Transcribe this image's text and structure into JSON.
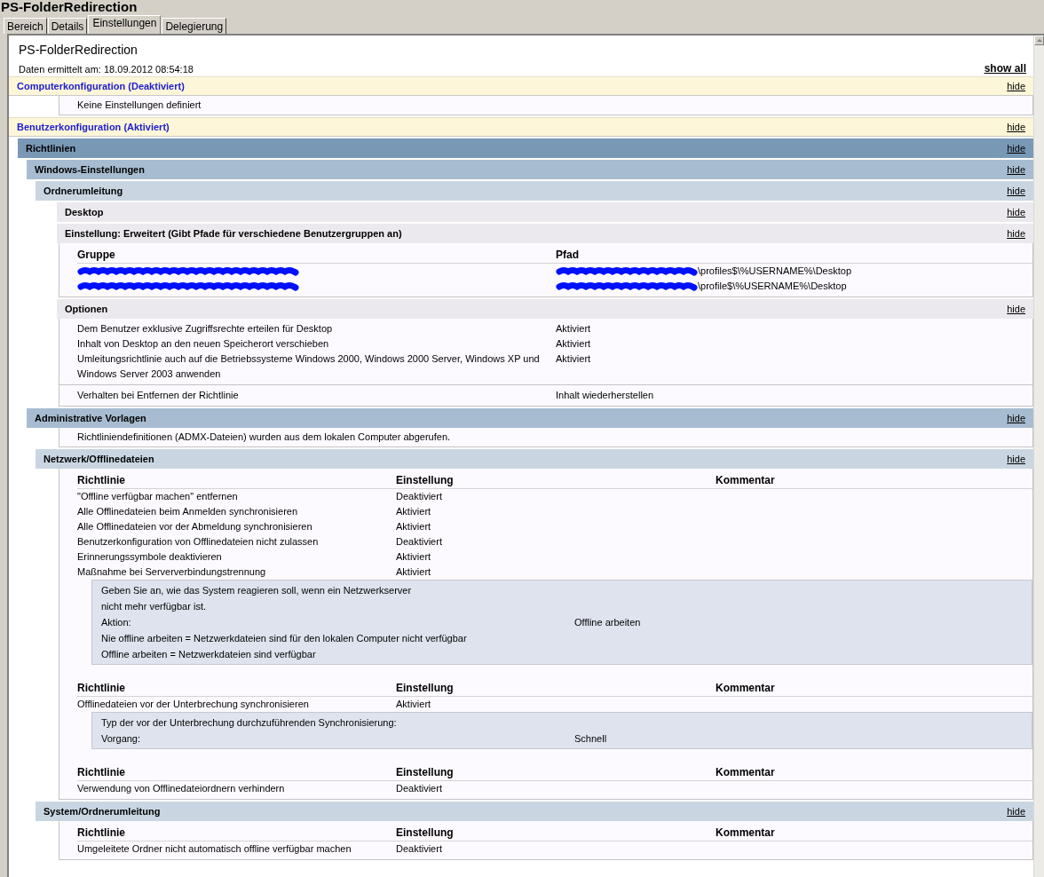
{
  "window": {
    "title": "PS-FolderRedirection"
  },
  "tabs": [
    {
      "label": "Bereich",
      "selected": false
    },
    {
      "label": "Details",
      "selected": false
    },
    {
      "label": "Einstellungen",
      "selected": true
    },
    {
      "label": "Delegierung",
      "selected": false
    }
  ],
  "report": {
    "title": "PS-FolderRedirection",
    "date": "Daten ermittelt am: 18.09.2012 08:54:18",
    "show_all": "show all",
    "sections": [
      {
        "kind": "config",
        "title": "Computerkonfiguration (Deaktiviert)",
        "hide": "hide",
        "blocks": [
          {
            "kind": "note",
            "text": "Keine Einstellungen definiert"
          }
        ]
      },
      {
        "kind": "config",
        "title": "Benutzerkonfiguration (Aktiviert)",
        "hide": "hide",
        "children": [
          {
            "kind": "group",
            "title": "Richtlinien",
            "hide": "hide",
            "children": [
              {
                "kind": "group",
                "title": "Windows-Einstellungen",
                "hide": "hide",
                "children": [
                  {
                    "kind": "group",
                    "title": "Ordnerumleitung",
                    "hide": "hide",
                    "children": [
                      {
                        "kind": "group",
                        "title": "Desktop",
                        "hide": "hide"
                      },
                      {
                        "kind": "group",
                        "title": "Einstellung: Erweitert (Gibt Pfade für verschiedene Benutzergruppen an)",
                        "hide": "hide",
                        "blocks": [
                          {
                            "kind": "table",
                            "columns": [
                              "Gruppe",
                              "Pfad"
                            ],
                            "rows": [
                              {
                                "cells": [
                                  {
                                    "redacted": true
                                  },
                                  {
                                    "redacted": true,
                                    "text": "\\profiles$\\%USERNAME%\\Desktop"
                                  }
                                ]
                              },
                              {
                                "cells": [
                                  {
                                    "redacted": true
                                  },
                                  {
                                    "redacted": true,
                                    "text": "\\profile$\\%USERNAME%\\Desktop"
                                  }
                                ]
                              }
                            ]
                          }
                        ]
                      },
                      {
                        "kind": "group",
                        "title": "Optionen",
                        "hide": "hide",
                        "blocks": [
                          {
                            "kind": "table",
                            "rows": [
                              {
                                "cells": [
                                  "Dem Benutzer exklusive Zugriffsrechte erteilen für Desktop",
                                  "Aktiviert"
                                ]
                              },
                              {
                                "cells": [
                                  "Inhalt von Desktop an den neuen Speicherort verschieben",
                                  "Aktiviert"
                                ]
                              },
                              {
                                "cells": [
                                  "Umleitungsrichtlinie auch auf die Betriebssysteme Windows 2000, Windows 2000 Server, Windows XP und Windows Server 2003 anwenden",
                                  "Aktiviert"
                                ]
                              }
                            ]
                          },
                          {
                            "kind": "table",
                            "rows": [
                              {
                                "cells": [
                                  "Verhalten bei Entfernen der Richtlinie",
                                  "Inhalt wiederherstellen"
                                ]
                              }
                            ]
                          }
                        ]
                      }
                    ]
                  }
                ]
              },
              {
                "kind": "group",
                "title": "Administrative Vorlagen",
                "hide": "hide",
                "blocks": [
                  {
                    "kind": "note",
                    "text": "Richtliniendefinitionen (ADMX-Dateien) wurden aus dem lokalen Computer abgerufen."
                  }
                ],
                "children": [
                  {
                    "kind": "group",
                    "title": "Netzwerk/Offlinedateien",
                    "hide": "hide",
                    "blocks": [
                      {
                        "kind": "table",
                        "columns": [
                          "Richtlinie",
                          "Einstellung",
                          "Kommentar"
                        ],
                        "rows": [
                          {
                            "cells": [
                              "\"Offline verfügbar machen\" entfernen",
                              "Deaktiviert"
                            ]
                          },
                          {
                            "cells": [
                              "Alle Offlinedateien beim Anmelden synchronisieren",
                              "Aktiviert"
                            ]
                          },
                          {
                            "cells": [
                              "Alle Offlinedateien vor der Abmeldung synchronisieren",
                              "Aktiviert"
                            ]
                          },
                          {
                            "cells": [
                              "Benutzerkonfiguration von Offlinedateien nicht zulassen",
                              "Deaktiviert"
                            ]
                          },
                          {
                            "cells": [
                              "Erinnerungssymbole deaktivieren",
                              "Aktiviert"
                            ]
                          },
                          {
                            "cells": [
                              "Maßnahme bei Serververbindungstrennung",
                              "Aktiviert"
                            ],
                            "details": [
                              {
                                "kind": "explain",
                                "text": "Geben Sie an, wie das System reagieren soll, wenn ein Netzwerkserver nicht mehr verfügbar ist."
                              },
                              {
                                "kind": "pair",
                                "label": "Aktion:",
                                "value": "Offline arbeiten"
                              },
                              {
                                "kind": "text",
                                "text": "Nie offline arbeiten = Netzwerkdateien sind für den lokalen Computer nicht verfügbar"
                              },
                              {
                                "kind": "text",
                                "text": "Offline arbeiten = Netzwerkdateien sind verfügbar"
                              }
                            ]
                          }
                        ]
                      },
                      {
                        "kind": "table",
                        "columns": [
                          "Richtlinie",
                          "Einstellung",
                          "Kommentar"
                        ],
                        "rows": [
                          {
                            "cells": [
                              "Offlinedateien vor der Unterbrechung synchronisieren",
                              "Aktiviert"
                            ],
                            "details": [
                              {
                                "kind": "text",
                                "text": "Typ der vor der Unterbrechung durchzuführenden Synchronisierung:"
                              },
                              {
                                "kind": "pair",
                                "label": "Vorgang:",
                                "value": "Schnell"
                              }
                            ]
                          }
                        ]
                      },
                      {
                        "kind": "table",
                        "columns": [
                          "Richtlinie",
                          "Einstellung",
                          "Kommentar"
                        ],
                        "rows": [
                          {
                            "cells": [
                              "Verwendung von Offlinedateiordnern verhindern",
                              "Deaktiviert"
                            ]
                          }
                        ]
                      }
                    ]
                  },
                  {
                    "kind": "group",
                    "title": "System/Ordnerumleitung",
                    "hide": "hide",
                    "blocks": [
                      {
                        "kind": "table",
                        "columns": [
                          "Richtlinie",
                          "Einstellung",
                          "Kommentar"
                        ],
                        "rows": [
                          {
                            "cells": [
                              "Umgeleitete Ordner nicht automatisch offline verfügbar machen",
                              "Deaktiviert"
                            ]
                          }
                        ]
                      }
                    ]
                  }
                ]
              }
            ]
          }
        ]
      }
    ]
  }
}
